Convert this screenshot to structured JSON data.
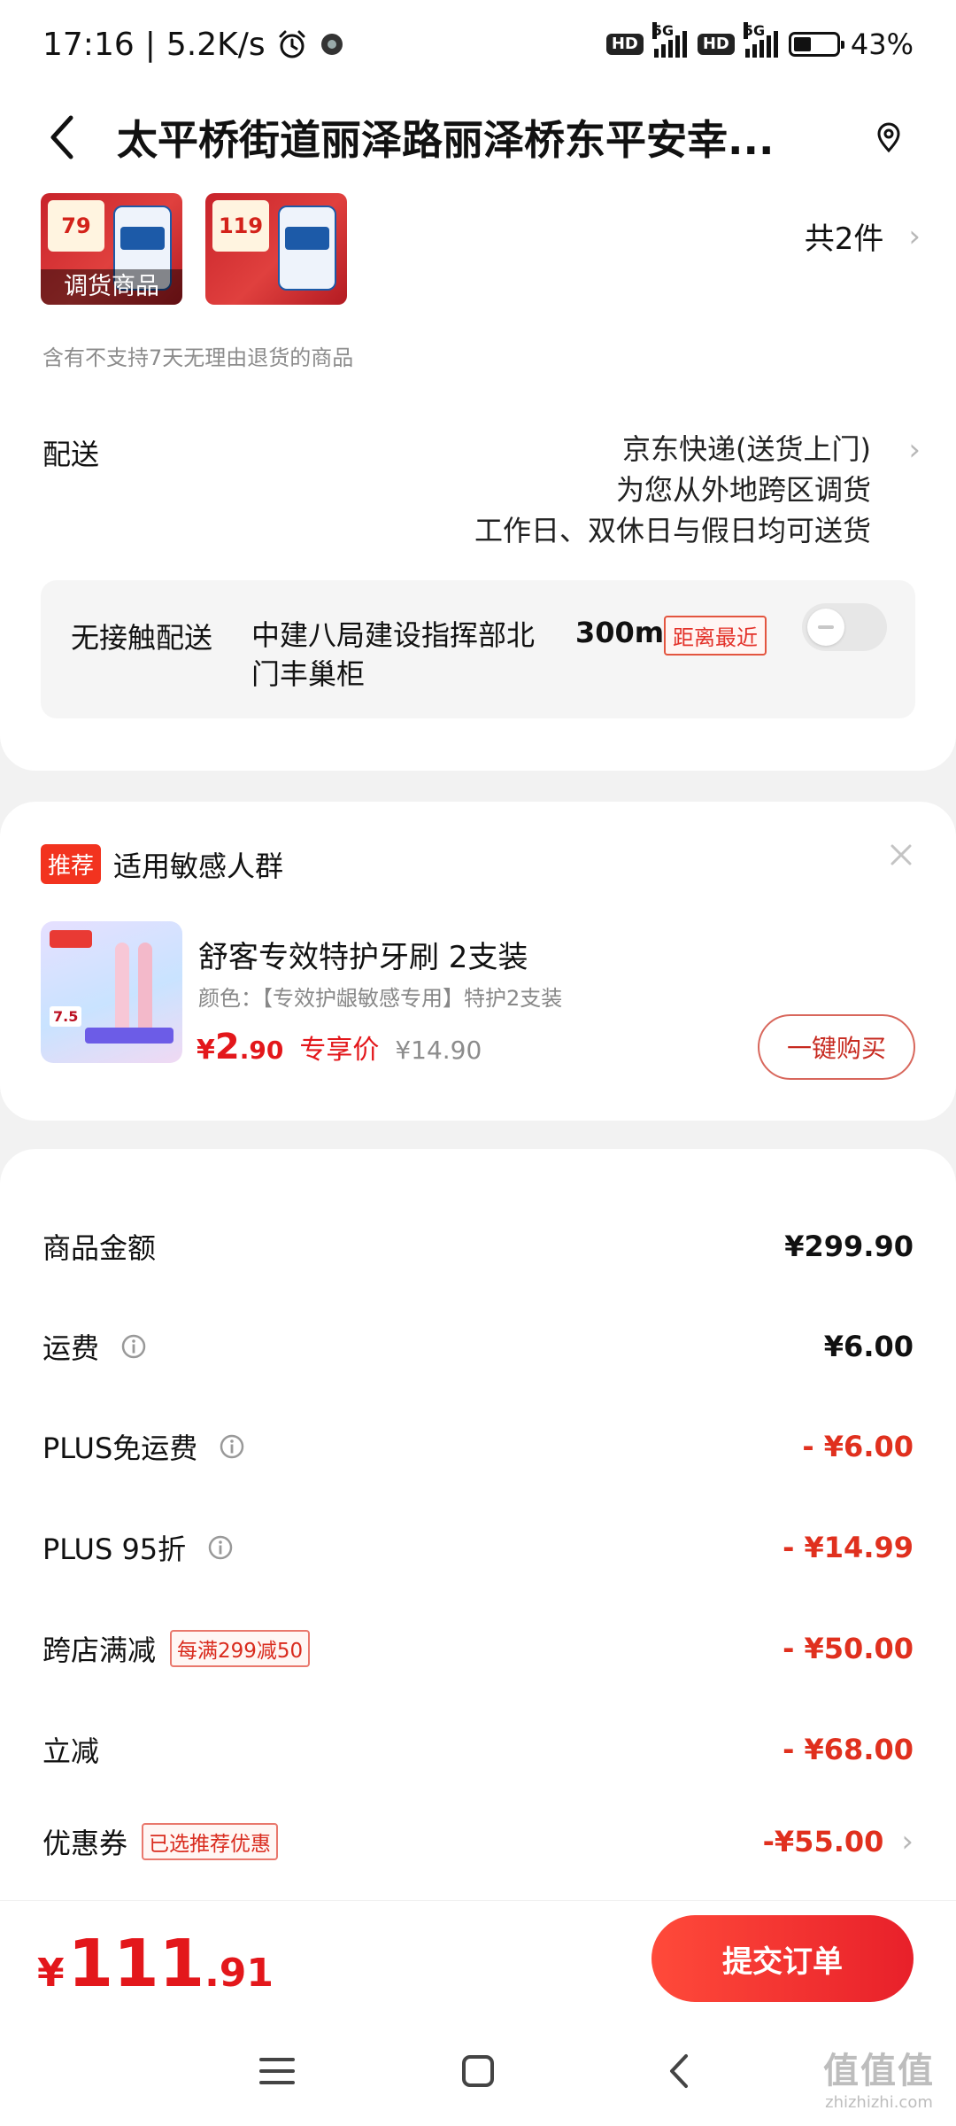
{
  "status_bar": {
    "time": "17:16",
    "net_speed": "5.2K/s",
    "sim1_hd": "HD",
    "sim1_net": "5G",
    "sim2_hd": "HD",
    "sim2_net": "5G",
    "battery": "43%"
  },
  "header": {
    "title": "太平桥街道丽泽路丽泽桥东平安幸...",
    "icons": [
      "back-arrow-icon",
      "location-pin-icon"
    ]
  },
  "products": {
    "items": [
      {
        "price_tag": "79",
        "overlay": "调货商品"
      },
      {
        "price_tag": "119",
        "overlay": ""
      }
    ],
    "count_label": "共2件",
    "note": "含有不支持7天无理由退货的商品"
  },
  "delivery": {
    "label": "配送",
    "method": "京东快递(送货上门)",
    "line2": "为您从外地跨区调货",
    "line3": "工作日、双休日与假日均可送货"
  },
  "contactless": {
    "label": "无接触配送",
    "location": "中建八局建设指挥部北门丰巢柜",
    "distance": "300m",
    "badge": "距离最近",
    "toggle_on": false
  },
  "recommend": {
    "badge": "推荐",
    "title": "适用敏感人群",
    "product_name": "舒客专效特护牙刷 2支装",
    "spec": "颜色：【专效护龈敏感专用】特护2支装",
    "price_symbol": "¥",
    "price_int": "2",
    "price_dec": ".90",
    "price_label": "专享价",
    "original_price": "¥14.90",
    "buy_button": "一键购买"
  },
  "breakdown": {
    "rows": [
      {
        "label": "商品金额",
        "value": "¥299.90"
      },
      {
        "label": "运费",
        "value": "¥6.00"
      },
      {
        "label": "PLUS免运费",
        "value": "- ¥6.00"
      },
      {
        "label": "PLUS 95折",
        "value": "- ¥14.99"
      },
      {
        "label": "跨店满减",
        "tag": "每满299减50",
        "value": "- ¥50.00"
      },
      {
        "label": "立减",
        "value": "- ¥68.00"
      },
      {
        "label": "优惠券",
        "tag": "已选推荐优惠",
        "value": "-¥55.00"
      }
    ]
  },
  "bottom": {
    "total_symbol": "¥",
    "total_int": "111",
    "total_dec": ".91",
    "submit_button": "提交订单"
  },
  "watermark": {
    "main": "值值值",
    "sub": "zhizhizhi.com"
  },
  "colors": {
    "accent_red": "#e3171b",
    "submit_gradient_start": "#ff4a3a",
    "submit_gradient_end": "#e8202a",
    "page_bg": "#f2f2f2"
  }
}
